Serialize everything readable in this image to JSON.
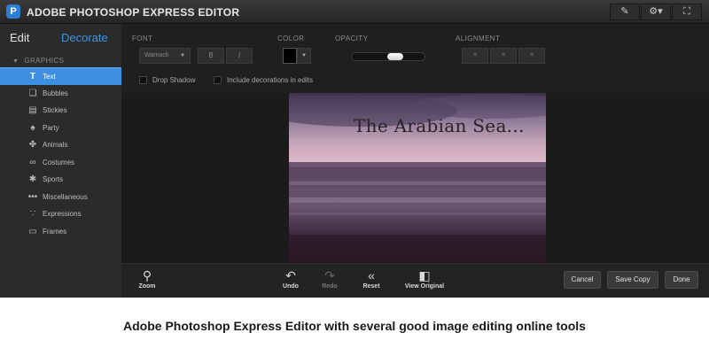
{
  "titlebar": {
    "logo": "P",
    "title": "ADOBE PHOTOSHOP EXPRESS EDITOR",
    "tools": [
      {
        "icon": "brush-icon",
        "glyph": "✎"
      },
      {
        "icon": "gear-icon",
        "glyph": "⚙▾"
      },
      {
        "icon": "fullscreen-icon",
        "glyph": "⛶"
      }
    ]
  },
  "sidebar": {
    "tab_edit": "Edit",
    "tab_decorate": "Decorate",
    "section": "GRAPHICS",
    "items": [
      {
        "label": "Text",
        "icon": "text-icon",
        "glyph": "T",
        "active": true
      },
      {
        "label": "Bubbles",
        "icon": "bubbles-icon",
        "glyph": "❏"
      },
      {
        "label": "Stickies",
        "icon": "stickies-icon",
        "glyph": "▤"
      },
      {
        "label": "Party",
        "icon": "party-icon",
        "glyph": "♠"
      },
      {
        "label": "Animals",
        "icon": "animals-icon",
        "glyph": "✤"
      },
      {
        "label": "Costumes",
        "icon": "costumes-icon",
        "glyph": "∞"
      },
      {
        "label": "Sports",
        "icon": "sports-icon",
        "glyph": "✱"
      },
      {
        "label": "Miscellaneous",
        "icon": "miscellaneous-icon",
        "glyph": "•••"
      },
      {
        "label": "Expressions",
        "icon": "expressions-icon",
        "glyph": "∵"
      },
      {
        "label": "Frames",
        "icon": "frames-icon",
        "glyph": "▭"
      }
    ]
  },
  "options": {
    "font_label": "FONT",
    "font_value": "Warnock",
    "bold": "B",
    "italic": "I",
    "color_label": "COLOR",
    "color_value": "#000000",
    "opacity_label": "OPACITY",
    "opacity_value": 0.6,
    "alignment_label": "ALIGNMENT",
    "align_left": "≡",
    "align_center": "≡",
    "align_right": "≡",
    "drop_shadow": "Drop Shadow",
    "include_decorations": "Include decorations in edits"
  },
  "canvas": {
    "overlay_text": "The Arabian Sea..."
  },
  "bottombar": {
    "zoom": "Zoom",
    "undo": "Undo",
    "redo": "Redo",
    "reset": "Reset",
    "view_original": "View Original",
    "cancel": "Cancel",
    "save_copy": "Save Copy",
    "done": "Done"
  },
  "caption": "Adobe Photoshop Express Editor with several good image editing online tools"
}
